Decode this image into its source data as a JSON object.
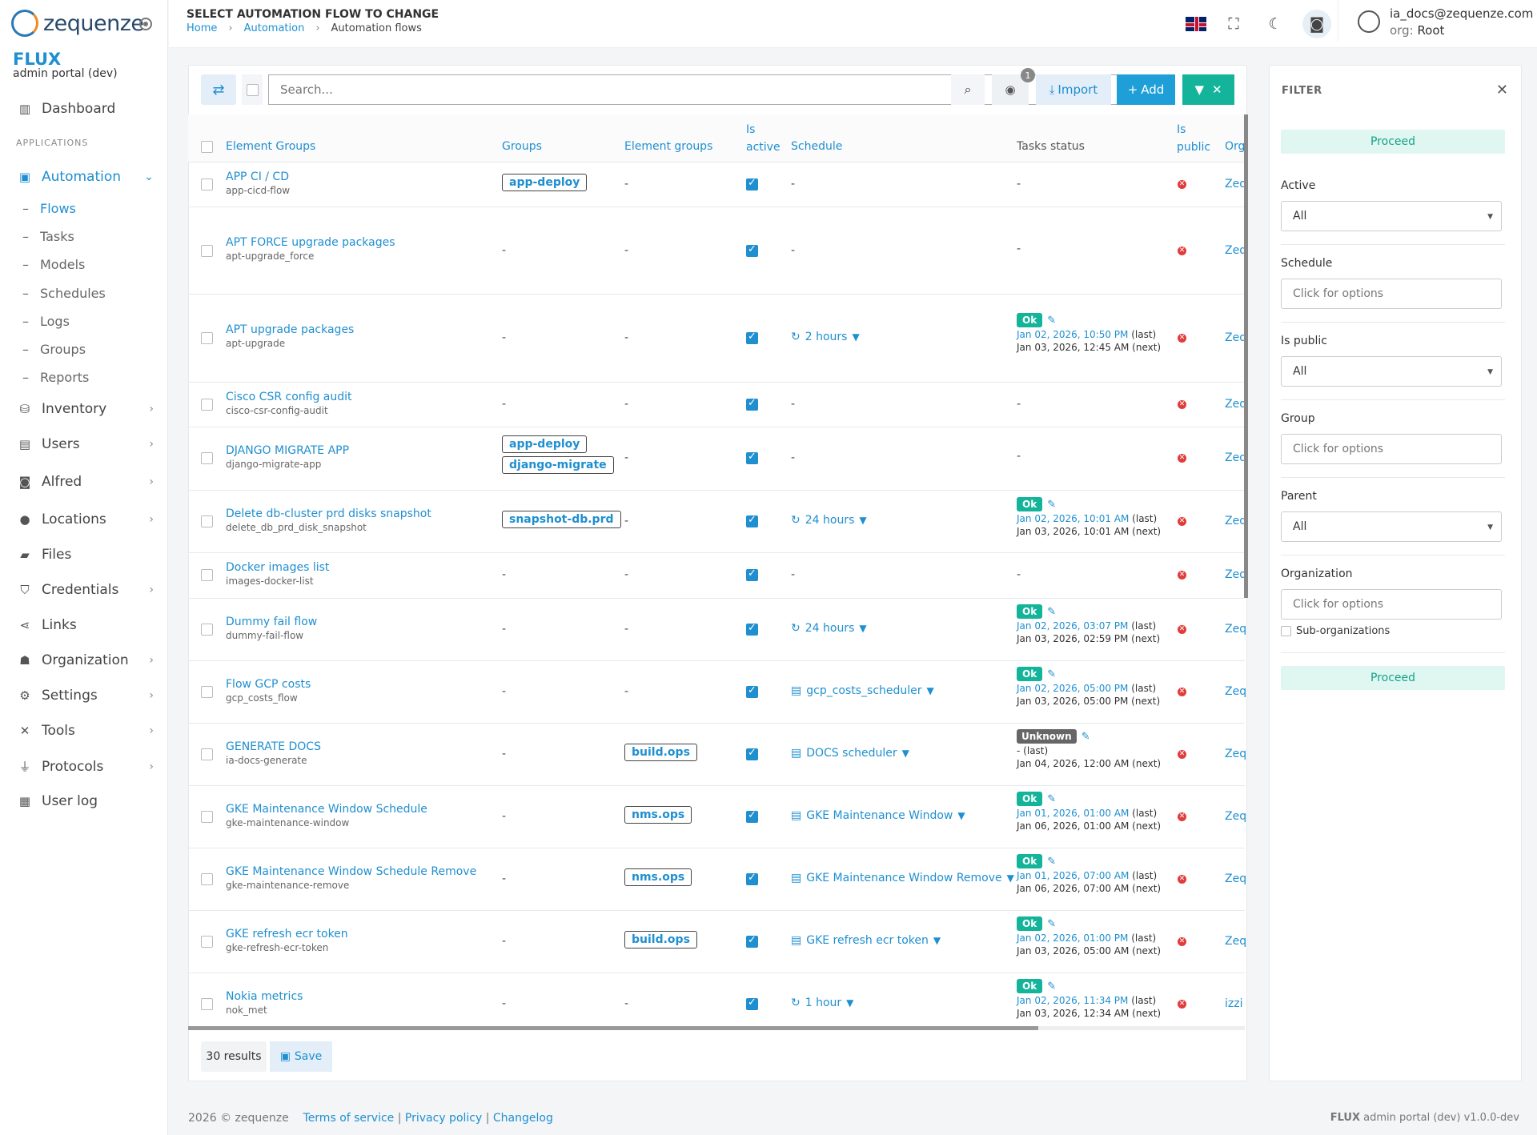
{
  "app": {
    "logo_text": "zequenze",
    "brand": "FLUX",
    "brand_sub": "admin portal (dev)"
  },
  "sidebar": {
    "section": "APPLICATIONS",
    "items": [
      {
        "label": "Dashboard",
        "icon": "bar-chart-icon"
      },
      {
        "label": "Automation",
        "icon": "chip-icon"
      },
      {
        "label": "Inventory",
        "icon": "boxes-icon"
      },
      {
        "label": "Users",
        "icon": "id-card-icon"
      },
      {
        "label": "Alfred",
        "icon": "robot-icon"
      },
      {
        "label": "Locations",
        "icon": "map-pin-icon"
      },
      {
        "label": "Files",
        "icon": "folder-icon"
      },
      {
        "label": "Credentials",
        "icon": "shield-icon"
      },
      {
        "label": "Links",
        "icon": "share-icon"
      },
      {
        "label": "Organization",
        "icon": "sitemap-icon"
      },
      {
        "label": "Settings",
        "icon": "cogs-icon"
      },
      {
        "label": "Tools",
        "icon": "tools-icon"
      },
      {
        "label": "Protocols",
        "icon": "plug-icon"
      },
      {
        "label": "User log",
        "icon": "calendar-icon"
      }
    ],
    "sub_items": [
      "Flows",
      "Tasks",
      "Models",
      "Schedules",
      "Logs",
      "Groups",
      "Reports"
    ]
  },
  "header": {
    "title": "SELECT AUTOMATION FLOW TO CHANGE",
    "breadcrumb": [
      "Home",
      "Automation",
      "Automation flows"
    ],
    "user_email": "ia_docs@zequenze.com",
    "org_label": "org:",
    "org_value": "Root"
  },
  "toolbar": {
    "search_placeholder": "Search...",
    "filter_count": "1",
    "import_label": "Import",
    "add_label": "Add"
  },
  "columns": {
    "name": "Element Groups",
    "groups": "Groups",
    "element_groups": "Element groups",
    "is_active_1": "Is",
    "is_active_2": "active",
    "schedule": "Schedule",
    "tasks_status": "Tasks status",
    "is_public_1": "Is",
    "is_public_2": "public",
    "org": "Org"
  },
  "rows": [
    {
      "name": "APP CI / CD",
      "slug": "app-cicd-flow",
      "groups": [
        "app-deploy"
      ],
      "element_groups": "-",
      "schedule": "-",
      "status": "-",
      "org": "Zeq"
    },
    {
      "name": "APT FORCE upgrade packages",
      "slug": "apt-upgrade_force",
      "groups": "-",
      "element_groups": "-",
      "schedule": "-",
      "status": "-",
      "org": "Zeq"
    },
    {
      "name": "APT upgrade packages",
      "slug": "apt-upgrade",
      "groups": "-",
      "element_groups": "-",
      "schedule": "2 hours",
      "schedule_icon": "refresh-icon",
      "status": "Ok",
      "last": "Jan 02, 2026, 10:50 PM",
      "next": "Jan 03, 2026, 12:45 AM (next)",
      "org": "Zeq"
    },
    {
      "name": "Cisco CSR config audit",
      "slug": "cisco-csr-config-audit",
      "groups": "-",
      "element_groups": "-",
      "schedule": "-",
      "status": "-",
      "org": "Zeq"
    },
    {
      "name": "DJANGO MIGRATE APP",
      "slug": "django-migrate-app",
      "groups": [
        "app-deploy",
        "django-migrate"
      ],
      "element_groups": "-",
      "schedule": "-",
      "status": "-",
      "org": "Zeq"
    },
    {
      "name": "Delete db-cluster prd disks snapshot",
      "slug": "delete_db_prd_disk_snapshot",
      "groups": [
        "snapshot-db.prd"
      ],
      "element_groups": "-",
      "schedule": "24 hours",
      "schedule_icon": "refresh-icon",
      "status": "Ok",
      "last": "Jan 02, 2026, 10:01 AM",
      "next": "Jan 03, 2026, 10:01 AM (next)",
      "org": "Zeq"
    },
    {
      "name": "Docker images list",
      "slug": "images-docker-list",
      "groups": "-",
      "element_groups": "-",
      "schedule": "-",
      "status": "-",
      "org": "Zeq"
    },
    {
      "name": "Dummy fail flow",
      "slug": "dummy-fail-flow",
      "groups": "-",
      "element_groups": "-",
      "schedule": "24 hours",
      "schedule_icon": "refresh-icon",
      "status": "Ok",
      "last": "Jan 02, 2026, 03:07 PM",
      "next": "Jan 03, 2026, 02:59 PM (next)",
      "org": "Zeq"
    },
    {
      "name": "Flow GCP costs",
      "slug": "gcp_costs_flow",
      "groups": "-",
      "element_groups": "-",
      "schedule": "gcp_costs_scheduler",
      "schedule_icon": "calendar-icon",
      "status": "Ok",
      "last": "Jan 02, 2026, 05:00 PM",
      "next": "Jan 03, 2026, 05:00 PM (next)",
      "org": "Zeq"
    },
    {
      "name": "GENERATE DOCS",
      "slug": "ia-docs-generate",
      "groups": "-",
      "element_groups": [
        "build.ops"
      ],
      "schedule": "DOCS scheduler",
      "schedule_icon": "calendar-icon",
      "status": "Unknown",
      "last": "-",
      "next": "Jan 04, 2026, 12:00 AM (next)",
      "org": "Zeq"
    },
    {
      "name": "GKE Maintenance Window Schedule",
      "slug": "gke-maintenance-window",
      "groups": "-",
      "element_groups": [
        "nms.ops"
      ],
      "schedule": "GKE Maintenance Window",
      "schedule_icon": "calendar-icon",
      "status": "Ok",
      "last": "Jan 01, 2026, 01:00 AM",
      "next": "Jan 06, 2026, 01:00 AM (next)",
      "org": "Zeq"
    },
    {
      "name": "GKE Maintenance Window Schedule Remove",
      "slug": "gke-maintenance-remove",
      "groups": "-",
      "element_groups": [
        "nms.ops"
      ],
      "schedule": "GKE Maintenance Window Remove",
      "schedule_icon": "calendar-icon",
      "status": "Ok",
      "last": "Jan 01, 2026, 07:00 AM",
      "next": "Jan 06, 2026, 07:00 AM (next)",
      "org": "Zeq"
    },
    {
      "name": "GKE refresh ecr token",
      "slug": "gke-refresh-ecr-token",
      "groups": "-",
      "element_groups": [
        "build.ops"
      ],
      "schedule": "GKE refresh ecr token",
      "schedule_icon": "calendar-icon",
      "status": "Ok",
      "last": "Jan 02, 2026, 01:00 PM",
      "next": "Jan 03, 2026, 05:00 AM (next)",
      "org": "Zeq"
    },
    {
      "name": "Nokia metrics",
      "slug": "nok_met",
      "groups": "-",
      "element_groups": "-",
      "schedule": "1 hour",
      "schedule_icon": "refresh-icon",
      "status": "Ok",
      "last": "Jan 02, 2026, 11:34 PM",
      "next": "Jan 03, 2026, 12:34 AM (next)",
      "org": "izzi"
    }
  ],
  "last_suffix": "(last)",
  "footer_bar": {
    "results": "30 results",
    "save_label": "Save"
  },
  "filter": {
    "title": "FILTER",
    "proceed": "Proceed",
    "active_label": "Active",
    "active_value": "All",
    "schedule_label": "Schedule",
    "schedule_placeholder": "Click for options",
    "public_label": "Is public",
    "public_value": "All",
    "group_label": "Group",
    "group_placeholder": "Click for options",
    "parent_label": "Parent",
    "parent_value": "All",
    "org_label": "Organization",
    "org_placeholder": "Click for options",
    "suborg_label": "Sub-organizations"
  },
  "footer": {
    "copyright": "2026 © zequenze",
    "terms": "Terms of service",
    "privacy": "Privacy policy",
    "changelog": "Changelog",
    "version_brand": "FLUX",
    "version_text": "admin portal (dev) v1.0.0-dev",
    "sep": "|"
  },
  "colors": {
    "accent": "#1f8fd0",
    "ok": "#13b49a",
    "error": "#e23b3b"
  }
}
